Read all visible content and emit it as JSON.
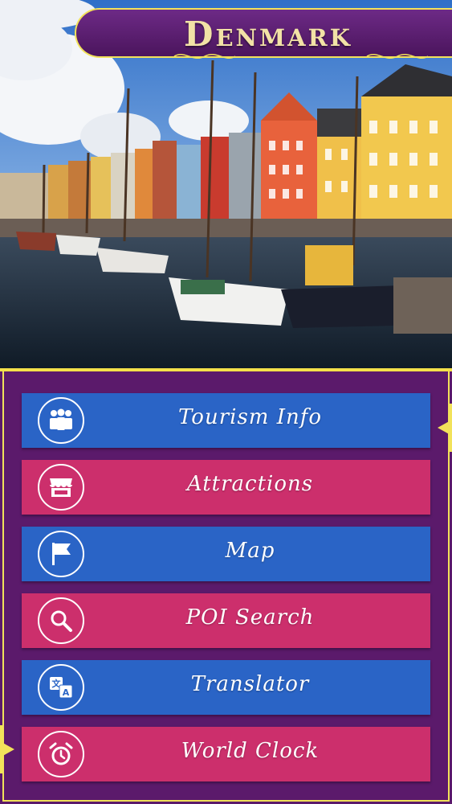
{
  "header": {
    "title": "Denmark"
  },
  "hero": {
    "image": "nyhavn-harbor-photo"
  },
  "menu": {
    "items": [
      {
        "label": "Tourism Info",
        "icon": "people-icon",
        "color": "#2a64c6"
      },
      {
        "label": "Attractions",
        "icon": "storefront-icon",
        "color": "#cc2f6c"
      },
      {
        "label": "Map",
        "icon": "flag-icon",
        "color": "#2a64c6"
      },
      {
        "label": "POI Search",
        "icon": "magnifier-icon",
        "color": "#cc2f6c"
      },
      {
        "label": "Translator",
        "icon": "translate-icon",
        "color": "#2a64c6"
      },
      {
        "label": "World Clock",
        "icon": "alarm-clock-icon",
        "color": "#cc2f6c"
      }
    ]
  },
  "colors": {
    "background": "#5c1a6b",
    "accent": "#f2e25a",
    "blue": "#2a64c6",
    "pink": "#cc2f6c"
  }
}
